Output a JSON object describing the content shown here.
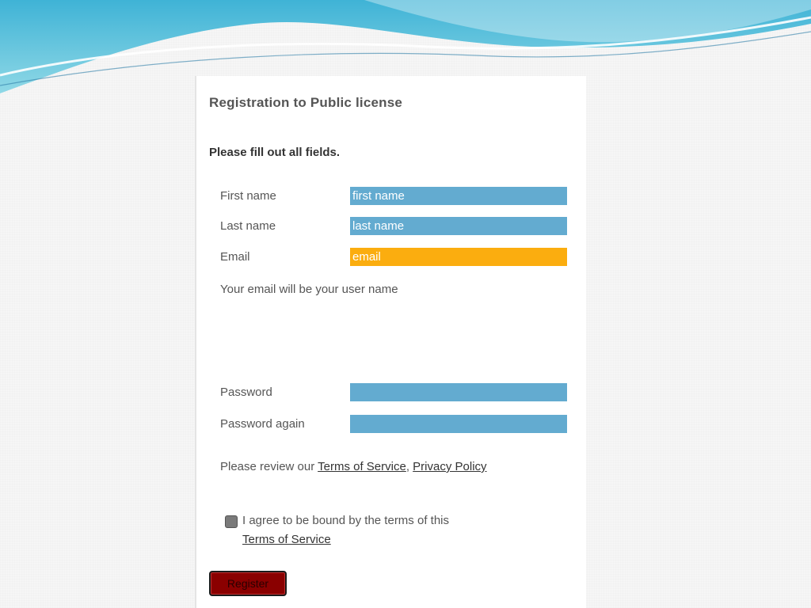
{
  "form": {
    "title": "Registration to Public license",
    "instruction": "Please fill out all fields.",
    "fields": {
      "first_name": {
        "label": "First name",
        "placeholder": "first name"
      },
      "last_name": {
        "label": "Last name",
        "placeholder": "last name"
      },
      "email": {
        "label": "Email",
        "placeholder": "email"
      },
      "password": {
        "label": "Password",
        "placeholder": ""
      },
      "password_again": {
        "label": "Password again",
        "placeholder": ""
      }
    },
    "email_note": "Your email will be your user name",
    "review": {
      "prefix": "Please review our ",
      "terms_link": "Terms of Service",
      "separator": ", ",
      "privacy_link": "Privacy Policy"
    },
    "agreement": {
      "text": "I agree to be bound by the terms of this",
      "link": "Terms of Service",
      "checked": false
    },
    "register_label": "Register"
  },
  "colors": {
    "field_blue": "#63abd0",
    "field_orange": "#fbad0f",
    "button_red": "#8a0000"
  }
}
